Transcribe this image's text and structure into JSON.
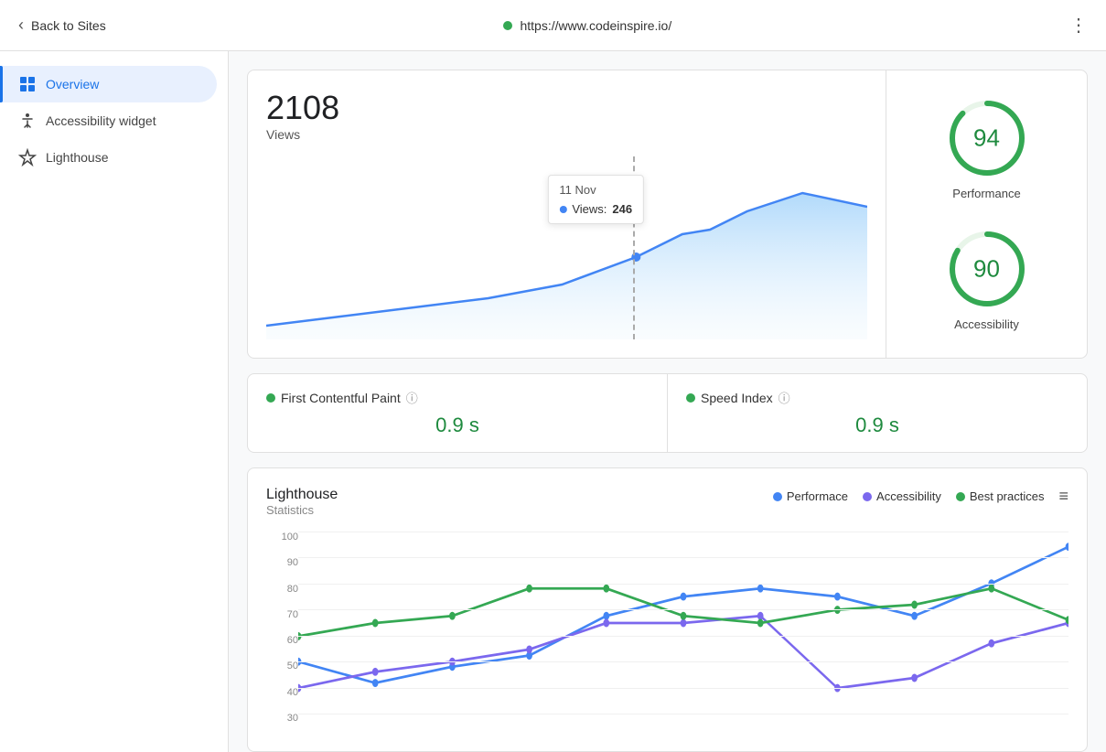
{
  "header": {
    "back_label": "Back to Sites",
    "url": "https://www.codeinspire.io/",
    "more_icon": "⋮"
  },
  "sidebar": {
    "items": [
      {
        "id": "overview",
        "label": "Overview",
        "active": true
      },
      {
        "id": "accessibility-widget",
        "label": "Accessibility widget",
        "active": false
      },
      {
        "id": "lighthouse",
        "label": "Lighthouse",
        "active": false
      }
    ]
  },
  "overview": {
    "views_count": "2108",
    "views_label": "Views",
    "tooltip": {
      "date": "11 Nov",
      "metric": "Views:",
      "value": "246"
    },
    "metrics": [
      {
        "id": "performance",
        "score": "94",
        "label": "Performance"
      },
      {
        "id": "accessibility",
        "score": "90",
        "label": "Accessibility"
      }
    ],
    "bottom_metrics": [
      {
        "id": "fcp",
        "label": "First Contentful Paint",
        "value": "0.9 s"
      },
      {
        "id": "speed-index",
        "label": "Speed Index",
        "value": "0.9 s"
      }
    ]
  },
  "lighthouse": {
    "title": "Lighthouse",
    "subtitle": "Statistics",
    "legend": [
      {
        "id": "performance",
        "label": "Performace",
        "color": "#4285f4"
      },
      {
        "id": "accessibility",
        "label": "Accessibility",
        "color": "#7b68ee"
      },
      {
        "id": "best-practices",
        "label": "Best practices",
        "color": "#34a853"
      }
    ],
    "y_axis": [
      "100",
      "90",
      "80",
      "70",
      "60",
      "50",
      "40",
      "30"
    ]
  }
}
